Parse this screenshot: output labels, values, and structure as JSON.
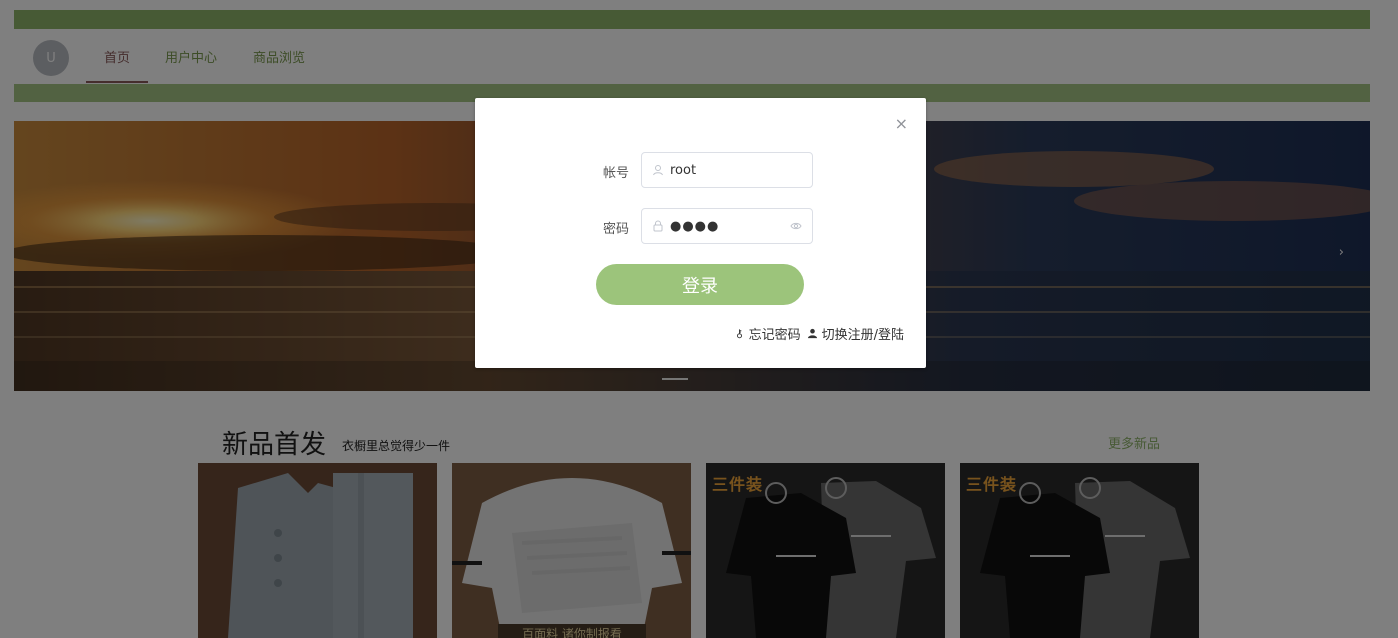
{
  "header": {
    "avatar_initial": "U",
    "nav": [
      {
        "label": "首页"
      },
      {
        "label": "用户中心"
      },
      {
        "label": "商品浏览"
      }
    ]
  },
  "banner": {
    "next_glyph": "›"
  },
  "section": {
    "title": "新品首发",
    "subtitle": "衣橱里总觉得少一件",
    "more": "更多新品",
    "products": [
      {
        "tag": ""
      },
      {
        "tag": "",
        "caption": "百面料 诸你制报看"
      },
      {
        "tag": "三件装"
      },
      {
        "tag": "三件装"
      }
    ]
  },
  "dialog": {
    "close_glyph": "×",
    "account_label": "帐号",
    "account_value": "root",
    "password_label": "密码",
    "password_mask": "●●●●",
    "login_label": "登录",
    "forgot_label": "忘记密码",
    "switch_label": "切换注册/登陆"
  },
  "colors": {
    "primary": "#9cc47b",
    "topbar": "#8fb46a",
    "greenbar": "#a4c585",
    "overlay": "rgba(0,0,0,0.5)"
  }
}
